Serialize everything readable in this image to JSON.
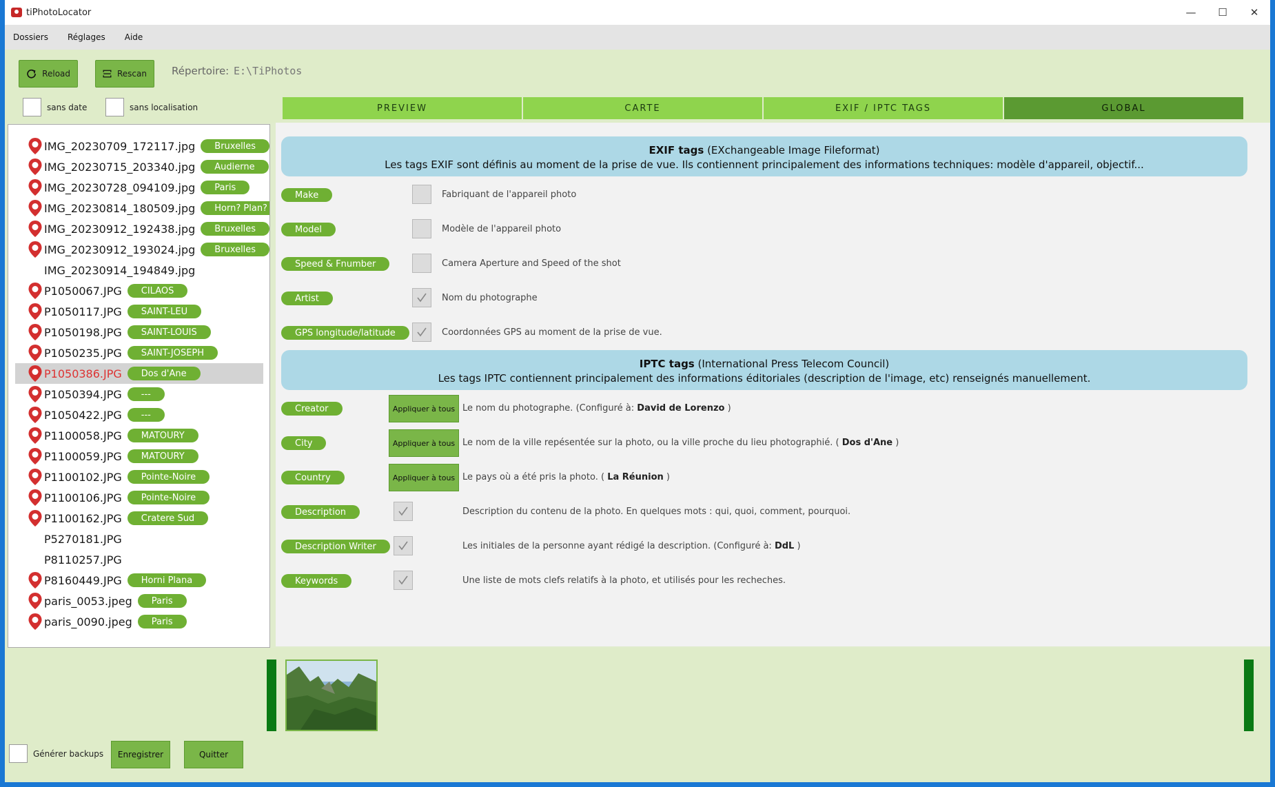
{
  "window": {
    "title": "tiPhotoLocator",
    "controls": [
      "—",
      "☐",
      "✕"
    ]
  },
  "menu": [
    "Dossiers",
    "Réglages",
    "Aide"
  ],
  "toolbar": {
    "reload_label": "Reload",
    "rescan_label": "Rescan",
    "repertoire_label": "Répertoire:",
    "repertoire_value": "E:\\TiPhotos"
  },
  "filters": {
    "sans_date": "sans date",
    "sans_localisation": "sans localisation"
  },
  "tabs": [
    {
      "label": "PREVIEW",
      "active": false
    },
    {
      "label": "CARTE",
      "active": false
    },
    {
      "label": "EXIF / IPTC TAGS",
      "active": false
    },
    {
      "label": "GLOBAL",
      "active": true
    }
  ],
  "files": [
    {
      "name": "IMG_20230709_172117.jpg",
      "location": "Bruxelles",
      "pin": true
    },
    {
      "name": "IMG_20230715_203340.jpg",
      "location": "Audierne",
      "pin": true
    },
    {
      "name": "IMG_20230728_094109.jpg",
      "location": "Paris",
      "pin": true
    },
    {
      "name": "IMG_20230814_180509.jpg",
      "location": "Horn? Plan?",
      "pin": true
    },
    {
      "name": "IMG_20230912_192438.jpg",
      "location": "Bruxelles",
      "pin": true
    },
    {
      "name": "IMG_20230912_193024.jpg",
      "location": "Bruxelles",
      "pin": true
    },
    {
      "name": "IMG_20230914_194849.jpg",
      "location": "",
      "pin": false
    },
    {
      "name": "P1050067.JPG",
      "location": "CILAOS",
      "pin": true
    },
    {
      "name": "P1050117.JPG",
      "location": "SAINT-LEU",
      "pin": true
    },
    {
      "name": "P1050198.JPG",
      "location": "SAINT-LOUIS",
      "pin": true
    },
    {
      "name": "P1050235.JPG",
      "location": "SAINT-JOSEPH",
      "pin": true
    },
    {
      "name": "P1050386.JPG",
      "location": "Dos d'Ane",
      "pin": true,
      "selected": true
    },
    {
      "name": "P1050394.JPG",
      "location": "---",
      "pin": true
    },
    {
      "name": "P1050422.JPG",
      "location": "---",
      "pin": true
    },
    {
      "name": "P1100058.JPG",
      "location": "MATOURY",
      "pin": true
    },
    {
      "name": "P1100059.JPG",
      "location": "MATOURY",
      "pin": true
    },
    {
      "name": "P1100102.JPG",
      "location": "Pointe-Noire",
      "pin": true
    },
    {
      "name": "P1100106.JPG",
      "location": "Pointe-Noire",
      "pin": true
    },
    {
      "name": "P1100162.JPG",
      "location": "Cratere Sud",
      "pin": true
    },
    {
      "name": "P5270181.JPG",
      "location": "",
      "pin": false
    },
    {
      "name": "P8110257.JPG",
      "location": "",
      "pin": false
    },
    {
      "name": "P8160449.JPG",
      "location": "Horni Plana",
      "pin": true
    },
    {
      "name": "paris_0053.jpeg",
      "location": "Paris",
      "pin": true
    },
    {
      "name": "paris_0090.jpeg",
      "location": "Paris",
      "pin": true
    }
  ],
  "exif": {
    "title": "EXIF tags",
    "title_suffix": "(EXchangeable Image Fileformat)",
    "subtitle": "Les tags EXIF sont définis au moment de la prise de vue. Ils contiennent principalement des informations techniques: modèle d'appareil, objectif...",
    "tags": [
      {
        "name": "Make",
        "checked": false,
        "desc": "Fabriquant de l'appareil photo"
      },
      {
        "name": "Model",
        "checked": false,
        "desc": "Modèle de l'appareil photo"
      },
      {
        "name": "Speed & Fnumber",
        "checked": false,
        "desc": "Camera Aperture and Speed of the shot"
      },
      {
        "name": "Artist",
        "checked": true,
        "desc": "Nom du photographe"
      },
      {
        "name": "GPS longitude/latitude",
        "checked": true,
        "desc": "Coordonnées GPS au moment de la prise de vue."
      }
    ]
  },
  "iptc": {
    "title": "IPTC tags",
    "title_suffix": "(International Press Telecom Council)",
    "subtitle": "Les tags IPTC contiennent principalement des informations éditoriales (description de l'image, etc) renseignés manuellement.",
    "apply_label": "Appliquer à tous",
    "creator": {
      "name": "Creator",
      "desc_pre": "Le nom du photographe. (Configuré à:",
      "value": "David de Lorenzo",
      "desc_post": ")"
    },
    "city": {
      "name": "City",
      "desc_pre": "Le nom de la ville repésentée sur la photo, ou la ville proche du lieu photographié. (",
      "value": "Dos d'Ane",
      "desc_post": ")"
    },
    "country": {
      "name": "Country",
      "desc_pre": "Le pays où a été pris la photo. (",
      "value": "La Réunion",
      "desc_post": ")"
    },
    "description": {
      "name": "Description",
      "checked": true,
      "desc": "Description du contenu de la photo. En quelques mots : qui, quoi, comment, pourquoi."
    },
    "writer": {
      "name": "Description Writer",
      "checked": true,
      "desc_pre": "Les initiales de la personne ayant rédigé la description. (Configuré à:",
      "value": "DdL",
      "desc_post": ")"
    },
    "keywords": {
      "name": "Keywords",
      "checked": true,
      "desc": "Une liste de mots clefs relatifs à la photo, et utilisés pour les recheches."
    }
  },
  "footer": {
    "backup_label": "Générer backups",
    "save_label": "Enregistrer",
    "quit_label": "Quitter"
  }
}
